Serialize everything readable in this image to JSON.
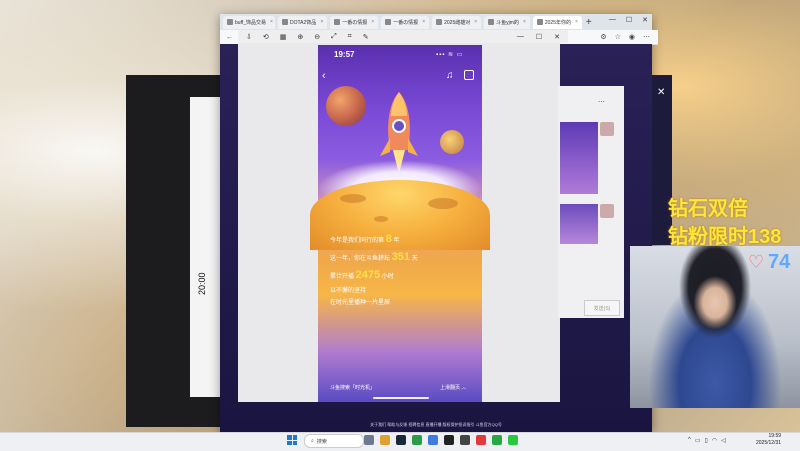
{
  "browser": {
    "tabs": [
      {
        "label": "buff_饰品交易"
      },
      {
        "label": "DOTA2饰品"
      },
      {
        "label": "一番の情报"
      },
      {
        "label": "一番の情报"
      },
      {
        "label": "2025雌雄对"
      },
      {
        "label": "斗鱼yjm的"
      },
      {
        "label": "2025年你的"
      }
    ],
    "footer_links": "关于我们  帮助与反馈  招聘信息  直播开播  版权保护投诉指引  斗鱼官方QQ号"
  },
  "phone": {
    "status_time": "19:57",
    "status_icons": "▪▪▪ ≋ ▭",
    "stats": {
      "line1_prefix": "今年是我们同行的第",
      "line1_num": "8",
      "line1_suffix": "年",
      "line2_prefix": "这一年，你在斗鱼耕耘",
      "line2_num": "351",
      "line2_suffix": "天",
      "line3_prefix": "累计开播",
      "line3_num": "2475",
      "line3_suffix": "小时",
      "line4": "以不懈的坚持",
      "line5": "在时光里播种一片星辰"
    },
    "footer_left": "斗鱼搜索「时光机」",
    "footer_right": "上滑翻页 ︿"
  },
  "chat": {
    "send_label": "发送(S)"
  },
  "left_app": {
    "time": "20:00"
  },
  "stream": {
    "promo_line1": "钻石双倍",
    "promo_line2": "钻粉限时138",
    "like_count": "74"
  },
  "taskbar": {
    "search_placeholder": "搜索",
    "clock_time": "19:59",
    "clock_date": "2025/12/31"
  },
  "colors": {
    "accent": "#ffe14a",
    "phone_top": "#5a2fae",
    "promo": "#ffe53a"
  }
}
